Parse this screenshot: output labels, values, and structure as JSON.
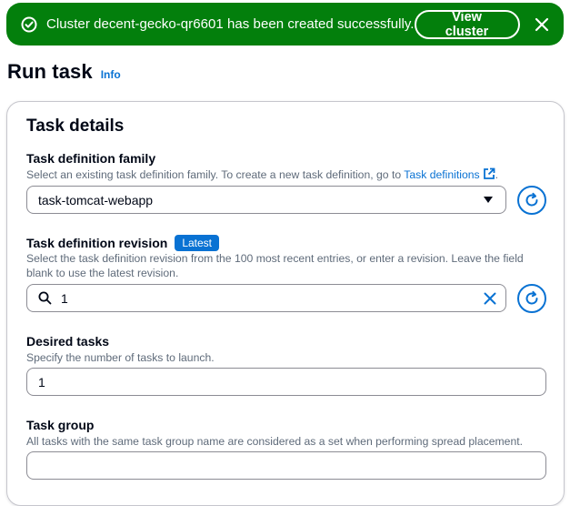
{
  "flash": {
    "message": "Cluster decent-gecko-qr6601 has been created successfully.",
    "view_button": "View cluster"
  },
  "page": {
    "title": "Run task",
    "info_link": "Info"
  },
  "task_details": {
    "heading": "Task details",
    "family": {
      "label": "Task definition family",
      "description": "Select an existing task definition family. To create a new task definition, go to ",
      "link_text": "Task definitions",
      "description_end": ".",
      "value": "task-tomcat-webapp"
    },
    "revision": {
      "label": "Task definition revision",
      "badge": "Latest",
      "description": "Select the task definition revision from the 100 most recent entries, or enter a revision. Leave the field blank to use the latest revision.",
      "value": "1"
    },
    "desired_tasks": {
      "label": "Desired tasks",
      "description": "Specify the number of tasks to launch.",
      "value": "1"
    },
    "task_group": {
      "label": "Task group",
      "description": "All tasks with the same task group name are considered as a set when performing spread placement.",
      "value": ""
    }
  },
  "colors": {
    "success": "#037f0c",
    "link": "#0972d3",
    "text": "#000716",
    "muted": "#5f6b7a"
  }
}
